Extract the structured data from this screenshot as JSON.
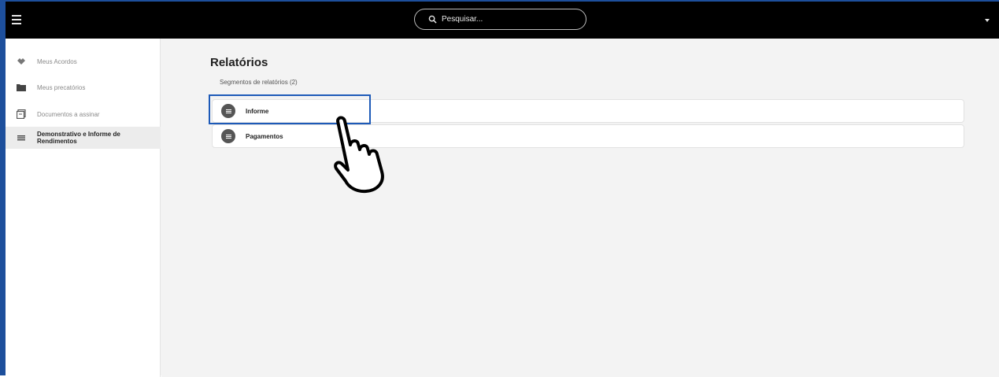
{
  "topbar": {
    "menu_icon": "hamburger-menu-icon",
    "search_placeholder": "Pesquisar...",
    "search_icon": "search-icon",
    "dropdown_icon": "caret-down-icon"
  },
  "sidebar": {
    "items": [
      {
        "label": "Meus Acordos",
        "icon": "handshake-icon",
        "active": false
      },
      {
        "label": "Meus precatórios",
        "icon": "folder-icon",
        "active": false
      },
      {
        "label": "Documentos a assinar",
        "icon": "document-sign-icon",
        "active": false
      },
      {
        "label": "Demonstrativo e Informe de Rendimentos",
        "icon": "list-icon",
        "active": true
      }
    ]
  },
  "main": {
    "title": "Relatórios",
    "subtitle": "Segmentos de relatórios (2)",
    "rows": [
      {
        "label": "Informe",
        "icon": "list-icon"
      },
      {
        "label": "Pagamentos",
        "icon": "list-icon"
      }
    ]
  },
  "overlay": {
    "pointer_icon": "pointing-hand-icon",
    "highlight_color": "#1d5ab8"
  },
  "colors": {
    "topbar": "#000000",
    "frame_border": "#1d4f9c",
    "background": "#f3f3f3"
  }
}
